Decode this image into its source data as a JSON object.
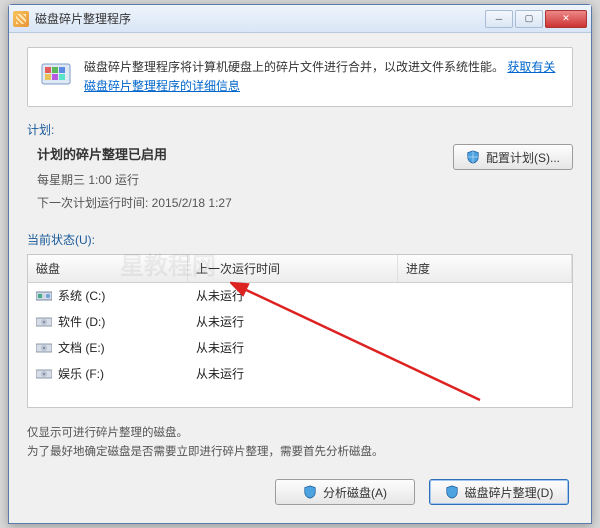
{
  "window": {
    "title": "磁盘碎片整理程序"
  },
  "infobox": {
    "text": "磁盘碎片整理程序将计算机硬盘上的碎片文件进行合并，以改进文件系统性能。",
    "link": "获取有关磁盘碎片整理程序的详细信息"
  },
  "labels": {
    "schedule": "计划:",
    "status": "当前状态(U):"
  },
  "schedule": {
    "enabled_title": "计划的碎片整理已启用",
    "recurrence": "每星期三 1:00 运行",
    "next_run_label": "下一次计划运行时间: ",
    "next_run_value": "2015/2/18 1:27",
    "configure_btn": "配置计划(S)..."
  },
  "columns": {
    "disk": "磁盘",
    "last": "上一次运行时间",
    "progress": "进度"
  },
  "rows": [
    {
      "name": "系统 (C:)",
      "icon": "sys",
      "last": "从未运行"
    },
    {
      "name": "软件 (D:)",
      "icon": "hdd",
      "last": "从未运行"
    },
    {
      "name": "文档 (E:)",
      "icon": "hdd",
      "last": "从未运行"
    },
    {
      "name": "娱乐 (F:)",
      "icon": "hdd",
      "last": "从未运行"
    }
  ],
  "notes": {
    "line1": "仅显示可进行碎片整理的磁盘。",
    "line2": "为了最好地确定磁盘是否需要立即进行碎片整理，需要首先分析磁盘。"
  },
  "buttons": {
    "analyze": "分析磁盘(A)",
    "defrag": "磁盘碎片整理(D)"
  },
  "watermark": "星教程网"
}
